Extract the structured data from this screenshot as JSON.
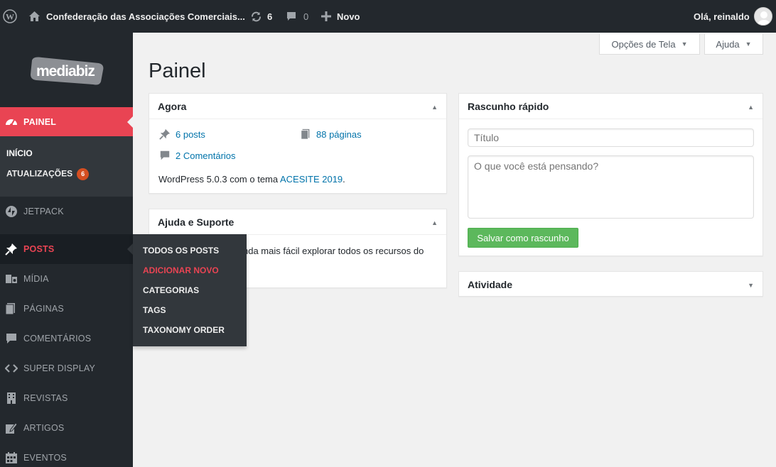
{
  "adminbar": {
    "site_name": "Confederação das Associações Comerciais...",
    "updates_count": "6",
    "comments_count": "0",
    "new_label": "Novo",
    "greeting": "Olá, reinaldo"
  },
  "sidebar": {
    "logo_text": "mediabiz",
    "current": "PAINEL",
    "submenu": {
      "home": "INÍCIO",
      "updates": "ATUALIZAÇÕES",
      "updates_badge": "6"
    },
    "items": [
      "JETPACK",
      "POSTS",
      "MÍDIA",
      "PÁGINAS",
      "COMENTÁRIOS",
      "SUPER DISPLAY",
      "REVISTAS",
      "ARTIGOS",
      "EVENTOS"
    ]
  },
  "flyout": [
    "TODOS OS POSTS",
    "ADICIONAR NOVO",
    "CATEGORIAS",
    "TAGS",
    "TAXONOMY ORDER"
  ],
  "screen_meta": {
    "options": "Opções de Tela",
    "help": "Ajuda"
  },
  "page_title": "Painel",
  "at_a_glance": {
    "title": "Agora",
    "posts": "6 posts",
    "pages": "88 páginas",
    "comments": "2 Comentários",
    "version_prefix": "WordPress 5.0.3 com o tema ",
    "theme": "ACESITE 2019",
    "version_suffix": "."
  },
  "help_box": {
    "title": "Ajuda e Suporte",
    "text_partial": "nda mais fácil explorar todos os recursos do"
  },
  "quick_draft": {
    "title": "Rascunho rápido",
    "title_placeholder": "Título",
    "content_placeholder": "O que você está pensando?",
    "save_label": "Salvar como rascunho"
  },
  "activity": {
    "title": "Atividade"
  },
  "colors": {
    "accent": "#e94453",
    "adminbar": "#23282d",
    "link": "#0073aa",
    "button": "#5cb85c"
  }
}
